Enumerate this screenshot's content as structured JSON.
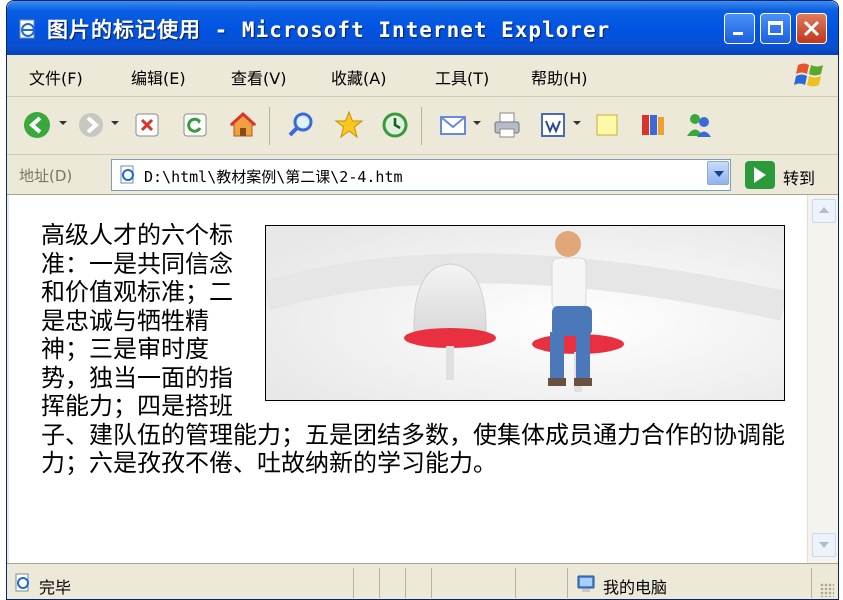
{
  "window": {
    "title": "图片的标记使用 - Microsoft Internet Explorer"
  },
  "menubar": {
    "items": [
      {
        "label": "文件(F)"
      },
      {
        "label": "编辑(E)"
      },
      {
        "label": "查看(V)"
      },
      {
        "label": "收藏(A)"
      },
      {
        "label": "工具(T)"
      },
      {
        "label": "帮助(H)"
      }
    ]
  },
  "toolbar": {
    "buttons": [
      "back-icon",
      "forward-icon",
      "stop-icon",
      "refresh-icon",
      "home-icon",
      "search-icon",
      "favorites-icon",
      "history-icon",
      "mail-icon",
      "print-icon",
      "edit-icon",
      "discuss-icon",
      "research-icon",
      "messenger-icon"
    ]
  },
  "addressbar": {
    "label": "地址(D)",
    "value": "D:\\html\\教材案例\\第二课\\2-4.htm",
    "go_label": "转到"
  },
  "page": {
    "paragraph": "高级人才的六个标准：一是共同信念和价值观标准；二是忠诚与牺牲精神；三是审时度势，独当一面的指挥能力；四是搭班子、建队伍的管理能力；五是团结多数，使集体成员通力合作的协调能力；六是孜孜不倦、吐故纳新的学习能力。"
  },
  "statusbar": {
    "text": "完毕",
    "zone": "我的电脑"
  },
  "colors": {
    "titlebar": "#0054e3",
    "window_bg": "#ece9d8",
    "close_button": "#c0381c"
  }
}
